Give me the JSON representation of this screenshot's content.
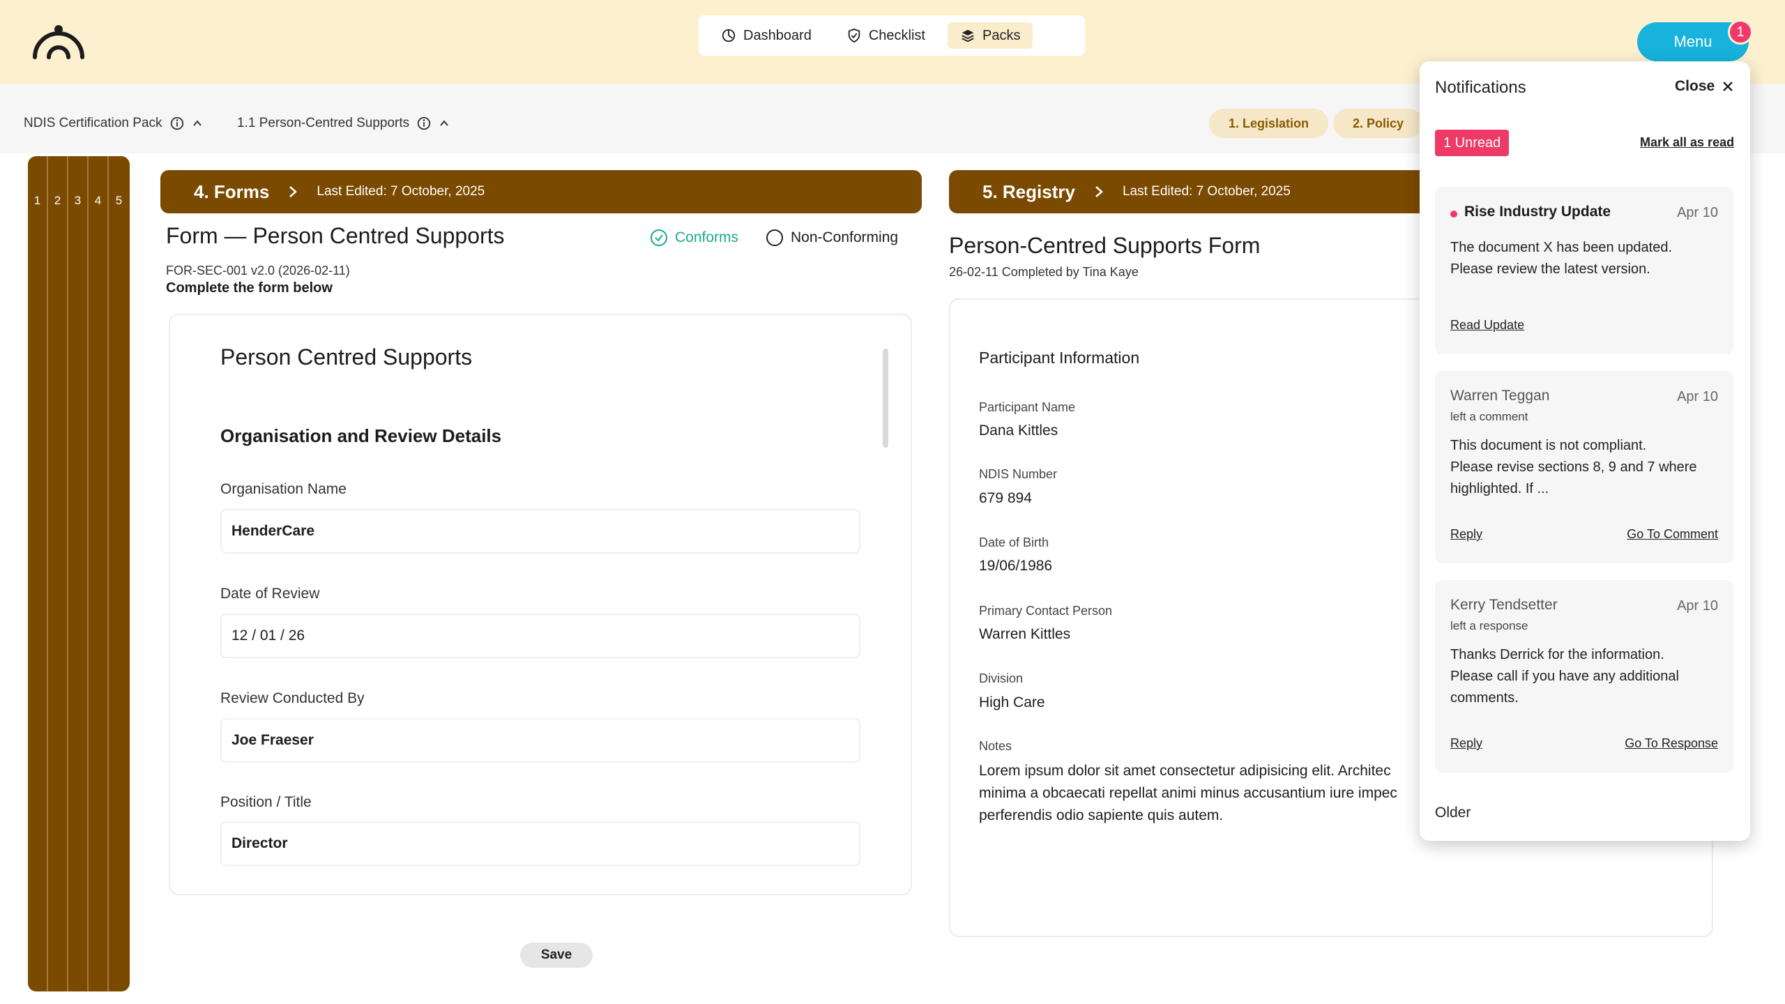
{
  "nav": {
    "items": [
      {
        "label": "Dashboard",
        "icon": "dashboard-icon"
      },
      {
        "label": "Checklist",
        "icon": "shield-check-icon"
      },
      {
        "label": "Packs",
        "icon": "layers-icon"
      }
    ],
    "active": "Packs",
    "menu_label": "Menu",
    "menu_badge": "1"
  },
  "breadcrumb": {
    "pack": "NDIS Certification Pack",
    "section": "1.1  Person-Centred Supports",
    "pills": [
      "1. Legislation",
      "2. Policy"
    ]
  },
  "tabstrip": [
    "1",
    "2",
    "3",
    "4",
    "5"
  ],
  "forms": {
    "bar_title": "4. Forms",
    "last_edited": "Last Edited: 7 October, 2025",
    "title": "Form — Person Centred Supports",
    "code": "FOR-SEC-001 v2.0 (2026-02-11)",
    "subtitle": "Complete the form below",
    "status": {
      "conforms": "Conforms",
      "non_conforming": "Non-Conforming"
    },
    "card_title": "Person Centred Supports",
    "section_title": "Organisation and Review Details",
    "fields": [
      {
        "label": "Organisation Name",
        "value": "HenderCare"
      },
      {
        "label": "Date of Review",
        "value": "12 / 01 / 26"
      },
      {
        "label": "Review Conducted By",
        "value": "Joe Fraeser"
      },
      {
        "label": "Position / Title",
        "value": "Director"
      }
    ],
    "save_label": "Save"
  },
  "registry": {
    "bar_title": "5. Registry",
    "last_edited": "Last Edited: 7 October, 2025",
    "title": "Person-Centred Supports Form",
    "subtitle": "26-02-11  Completed by Tina Kaye",
    "card_heading": "Participant Information",
    "fields": [
      {
        "label": "Participant Name",
        "value": "Dana Kittles"
      },
      {
        "label": "NDIS Number",
        "value": "679 894"
      },
      {
        "label": "Date of Birth",
        "value": "19/06/1986"
      },
      {
        "label": "Primary Contact Person",
        "value": "Warren Kittles"
      },
      {
        "label": "Division",
        "value": "High Care"
      }
    ],
    "notes_label": "Notes",
    "notes": [
      "Lorem ipsum dolor sit amet consectetur adipisicing elit. Architec",
      "minima a obcaecati repellat animi minus accusantium iure impec",
      "perferendis odio sapiente quis autem."
    ]
  },
  "notifications": {
    "title": "Notifications",
    "close_label": "Close",
    "unread_label": "1 Unread",
    "mark_all": "Mark all as read",
    "items": [
      {
        "who": "Rise Industry Update",
        "date": "Apr 10",
        "action": "",
        "lines": [
          "The document X has been updated.",
          "Please review the latest version."
        ],
        "link_left": "Read Update",
        "link_right": ""
      },
      {
        "who": "Warren Teggan",
        "date": "Apr 10",
        "action": "left a comment",
        "lines": [
          "This document is not compliant.",
          "Please revise sections 8, 9 and 7 where",
          "highlighted. If ..."
        ],
        "link_left": "Reply",
        "link_right": "Go To Comment"
      },
      {
        "who": "Kerry Tendsetter",
        "date": "Apr 10",
        "action": "left a response",
        "lines": [
          "Thanks Derrick for the information.",
          "Please call if you have any additional",
          "comments."
        ],
        "link_left": "Reply",
        "link_right": "Go To Response"
      }
    ],
    "older_label": "Older"
  },
  "colors": {
    "header_bg": "#fdf0cf",
    "brand_brown": "#7a4a00",
    "menu_blue": "#17b3dc",
    "alert_pink": "#ee3a66",
    "conforms_teal": "#1aa98f"
  }
}
